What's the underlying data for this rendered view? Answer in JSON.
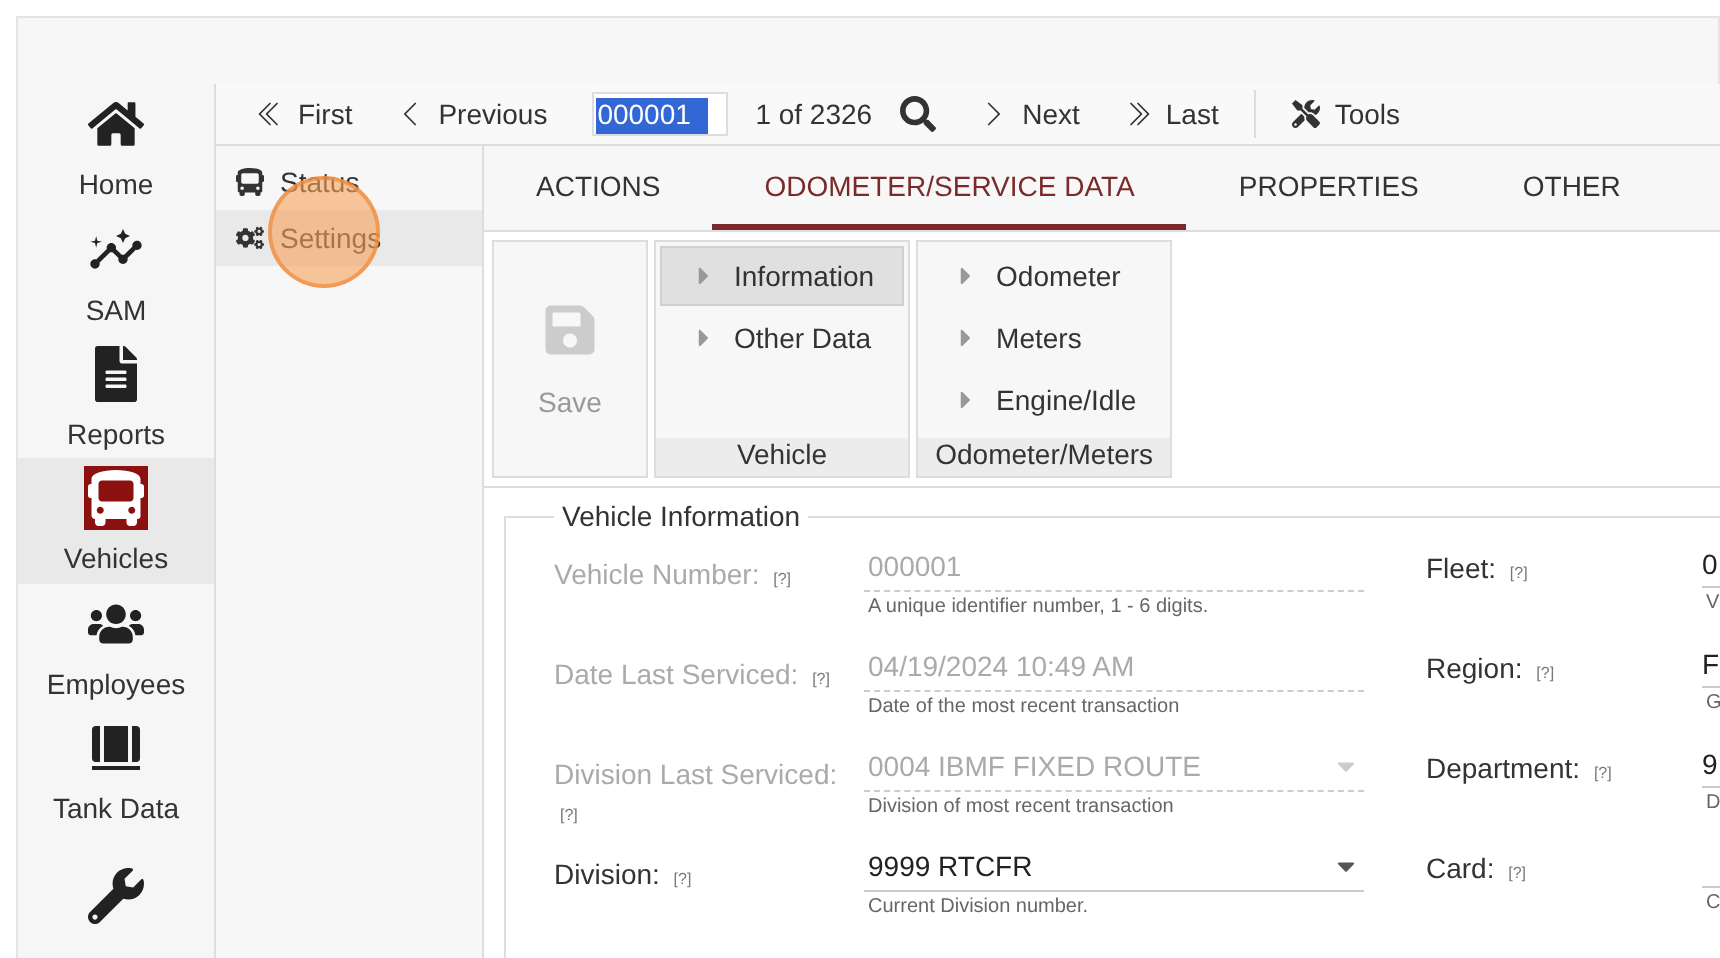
{
  "nav": {
    "items": [
      {
        "label": "Home",
        "selected": false
      },
      {
        "label": "SAM",
        "selected": false
      },
      {
        "label": "Reports",
        "selected": false
      },
      {
        "label": "Vehicles",
        "selected": true
      },
      {
        "label": "Employees",
        "selected": false
      },
      {
        "label": "Tank Data",
        "selected": false
      },
      {
        "selected": false
      }
    ]
  },
  "toolbar": {
    "first": "First",
    "previous": "Previous",
    "record": "000001",
    "count": "1 of 2326",
    "next": "Next",
    "last": "Last",
    "tools": "Tools"
  },
  "subnav": [
    {
      "label": "Status",
      "selected": false
    },
    {
      "label": "Settings",
      "selected": true
    }
  ],
  "tabs": [
    {
      "label": "ACTIONS",
      "selected": false
    },
    {
      "label": "ODOMETER/SERVICE DATA",
      "selected": true
    },
    {
      "label": "PROPERTIES",
      "selected": false
    },
    {
      "label": "OTHER",
      "selected": false
    }
  ],
  "ribbon": {
    "save": {
      "label": "Save",
      "disabled": true
    },
    "groups": [
      {
        "title": "Vehicle",
        "items": [
          {
            "label": "Information",
            "selected": true
          },
          {
            "label": "Other Data",
            "selected": false
          }
        ]
      },
      {
        "title": "Odometer/Meters",
        "items": [
          {
            "label": "Odometer",
            "selected": false
          },
          {
            "label": "Meters",
            "selected": false
          },
          {
            "label": "Engine/Idle",
            "selected": false
          }
        ]
      }
    ]
  },
  "form": {
    "legend": "Vehicle Information",
    "help": "[?]",
    "left": [
      {
        "label": "Vehicle Number:",
        "value": "000001",
        "hint": "A unique identifier number, 1 - 6 digits.",
        "disabled": true,
        "kind": "text"
      },
      {
        "label": "Date Last Serviced:",
        "value": "04/19/2024 10:49 AM",
        "hint": "Date of the most recent transaction",
        "disabled": true,
        "kind": "text"
      },
      {
        "label": "Division Last Serviced:",
        "value": "0004 IBMF FIXED ROUTE",
        "hint": "Division of most recent transaction",
        "disabled": true,
        "kind": "select"
      },
      {
        "label": "Division:",
        "value": "9999 RTCFR",
        "hint": "Current Division number.",
        "disabled": false,
        "kind": "select"
      }
    ],
    "right": [
      {
        "label": "Fleet:",
        "value": "0",
        "hint": "V"
      },
      {
        "label": "Region:",
        "value": "F",
        "hint": "G"
      },
      {
        "label": "Department:",
        "value": "9",
        "hint": "D"
      },
      {
        "label": "Card:",
        "hint": "C"
      }
    ]
  }
}
